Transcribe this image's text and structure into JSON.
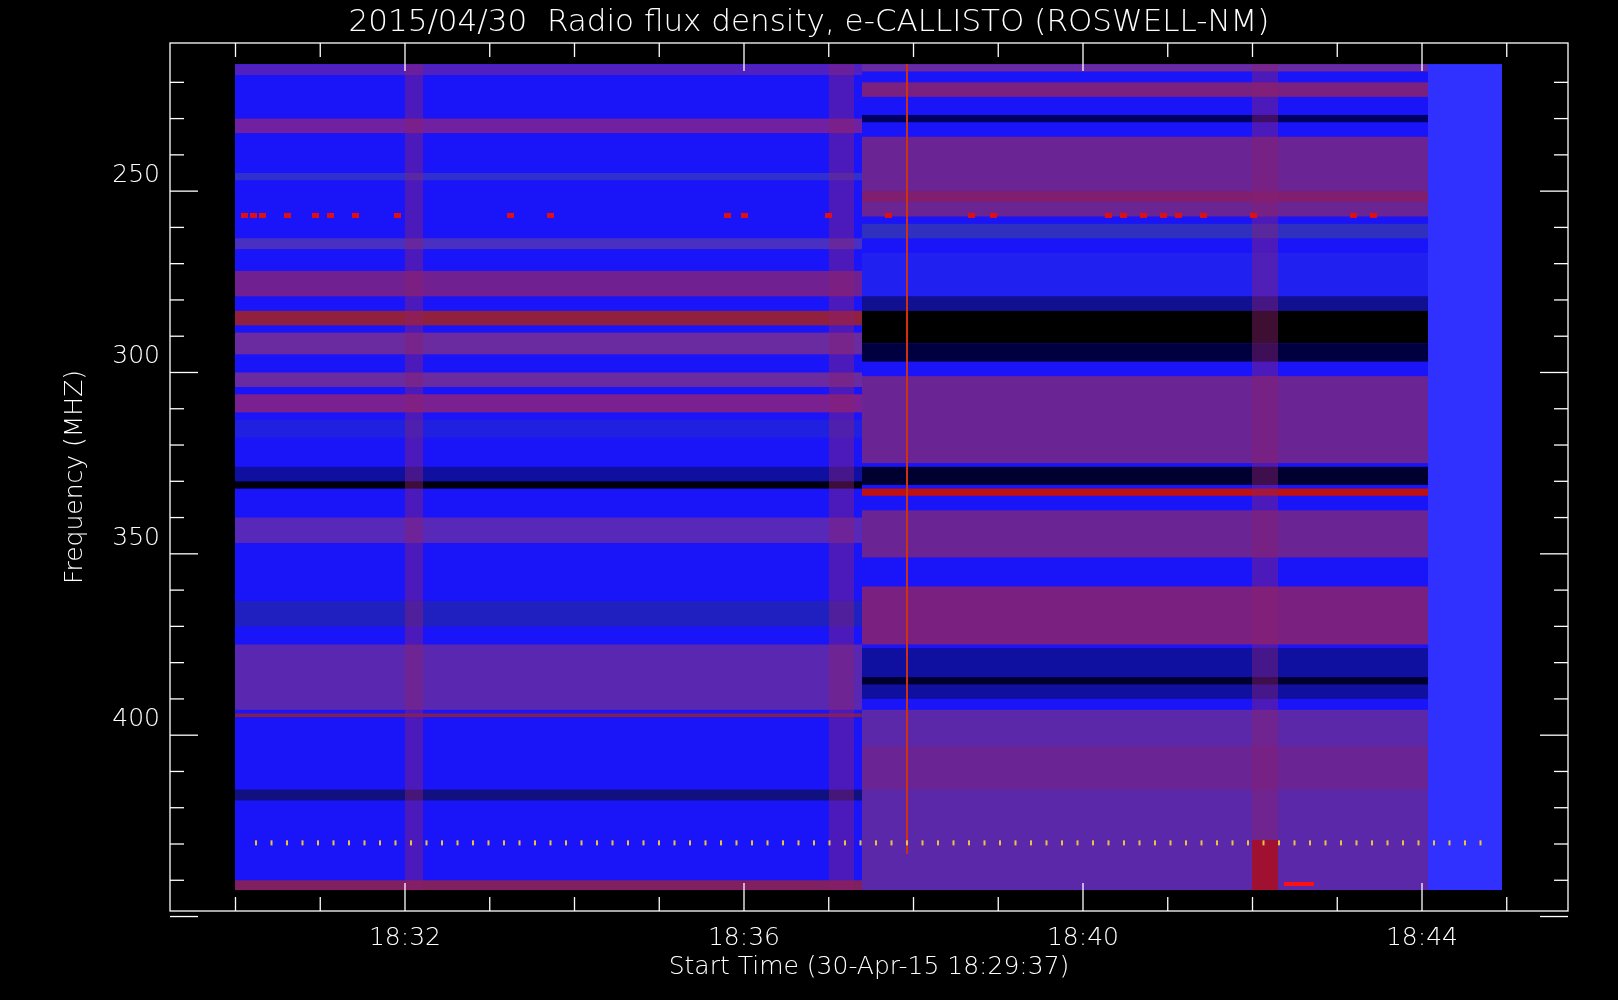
{
  "title": "2015/04/30  Radio flux density, e-CALLISTO (ROSWELL-NM)",
  "y_axis": {
    "label": "Frequency (MHZ)",
    "ticks": [
      "250",
      "300",
      "350",
      "400"
    ]
  },
  "x_axis": {
    "label": "Start Time (30-Apr-15 18:29:37)",
    "ticks": [
      "18:32",
      "18:36",
      "18:40",
      "18:44"
    ]
  }
}
